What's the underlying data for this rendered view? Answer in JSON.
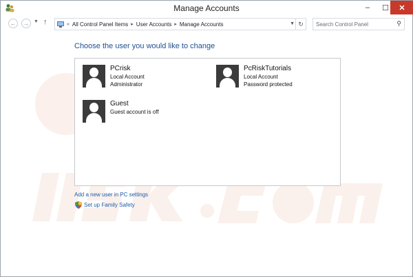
{
  "window": {
    "title": "Manage Accounts",
    "controls": {
      "minimize": "–",
      "maximize": "☐",
      "close": "✕"
    }
  },
  "navbar": {
    "back_icon": "←",
    "forward_icon": "→",
    "dropdown_icon": "▼",
    "up_icon": "↑",
    "breadcrumb": {
      "overflow": "«",
      "items": [
        "All Control Panel Items",
        "User Accounts",
        "Manage Accounts"
      ],
      "separator": "▸"
    },
    "address_dropdown_icon": "▼",
    "refresh_icon": "↻",
    "search_placeholder": "Search Control Panel",
    "search_icon": "⚲"
  },
  "main": {
    "heading": "Choose the user you would like to change",
    "accounts": [
      {
        "name": "PCrisk",
        "type": "Local Account",
        "detail": "Administrator"
      },
      {
        "name": "PcRiskTutorials",
        "type": "Local Account",
        "detail": "Password protected"
      },
      {
        "name": "Guest",
        "type": "Guest account is off",
        "detail": ""
      }
    ],
    "links": {
      "add_user": "Add a new user in PC settings",
      "family_safety": "Set up Family Safety"
    }
  },
  "colors": {
    "heading": "#1e4f91",
    "link": "#1e5da8",
    "close_button": "#c7392a",
    "avatar_bg": "#3b3b3b"
  }
}
